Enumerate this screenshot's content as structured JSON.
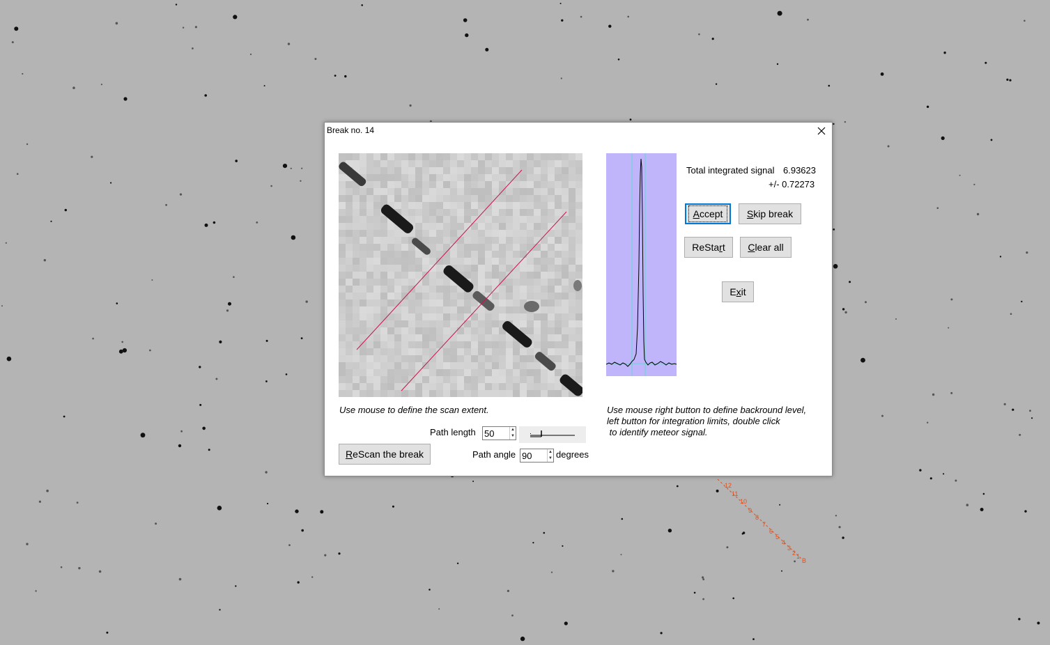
{
  "background": {
    "track_labels": [
      "12",
      "11",
      "10",
      "9",
      "8",
      "7",
      "6",
      "5",
      "4",
      "3",
      "2",
      "1"
    ],
    "track_end_label": "B",
    "track_color": "#e0501a"
  },
  "dialog": {
    "title": "Break no. 14",
    "close_glyph": "✕",
    "scan_hint": "Use mouse to define the scan extent.",
    "path_length_label": "Path length",
    "path_length_value": "50",
    "path_angle_label": "Path angle",
    "path_angle_value": "90",
    "degrees_label": "degrees",
    "rescan_button": {
      "pre": "",
      "u": "R",
      "post": "eScan the break"
    },
    "signal_label": "Total integrated signal",
    "signal_value": "6.93623",
    "error_value": "+/- 0.72273",
    "accept_button": {
      "pre": "",
      "u": "A",
      "post": "ccept"
    },
    "skip_button": {
      "pre": "",
      "u": "S",
      "post": "kip break"
    },
    "restart_button": {
      "pre": "ReSta",
      "u": "r",
      "post": "t"
    },
    "clear_button": {
      "pre": "",
      "u": "C",
      "post": "lear all"
    },
    "exit_button": {
      "pre": "E",
      "u": "x",
      "post": "it"
    },
    "profile_hint_1": "Use mouse right button to define backround level,",
    "profile_hint_2": "left button for integration limits, double click",
    "profile_hint_3": " to identify meteor signal.",
    "colors": {
      "scan_line": "#c8144a",
      "profile_bg": "#c0b4fb",
      "profile_limit": "#5fd8d0",
      "focus_border": "#0078d7"
    }
  }
}
